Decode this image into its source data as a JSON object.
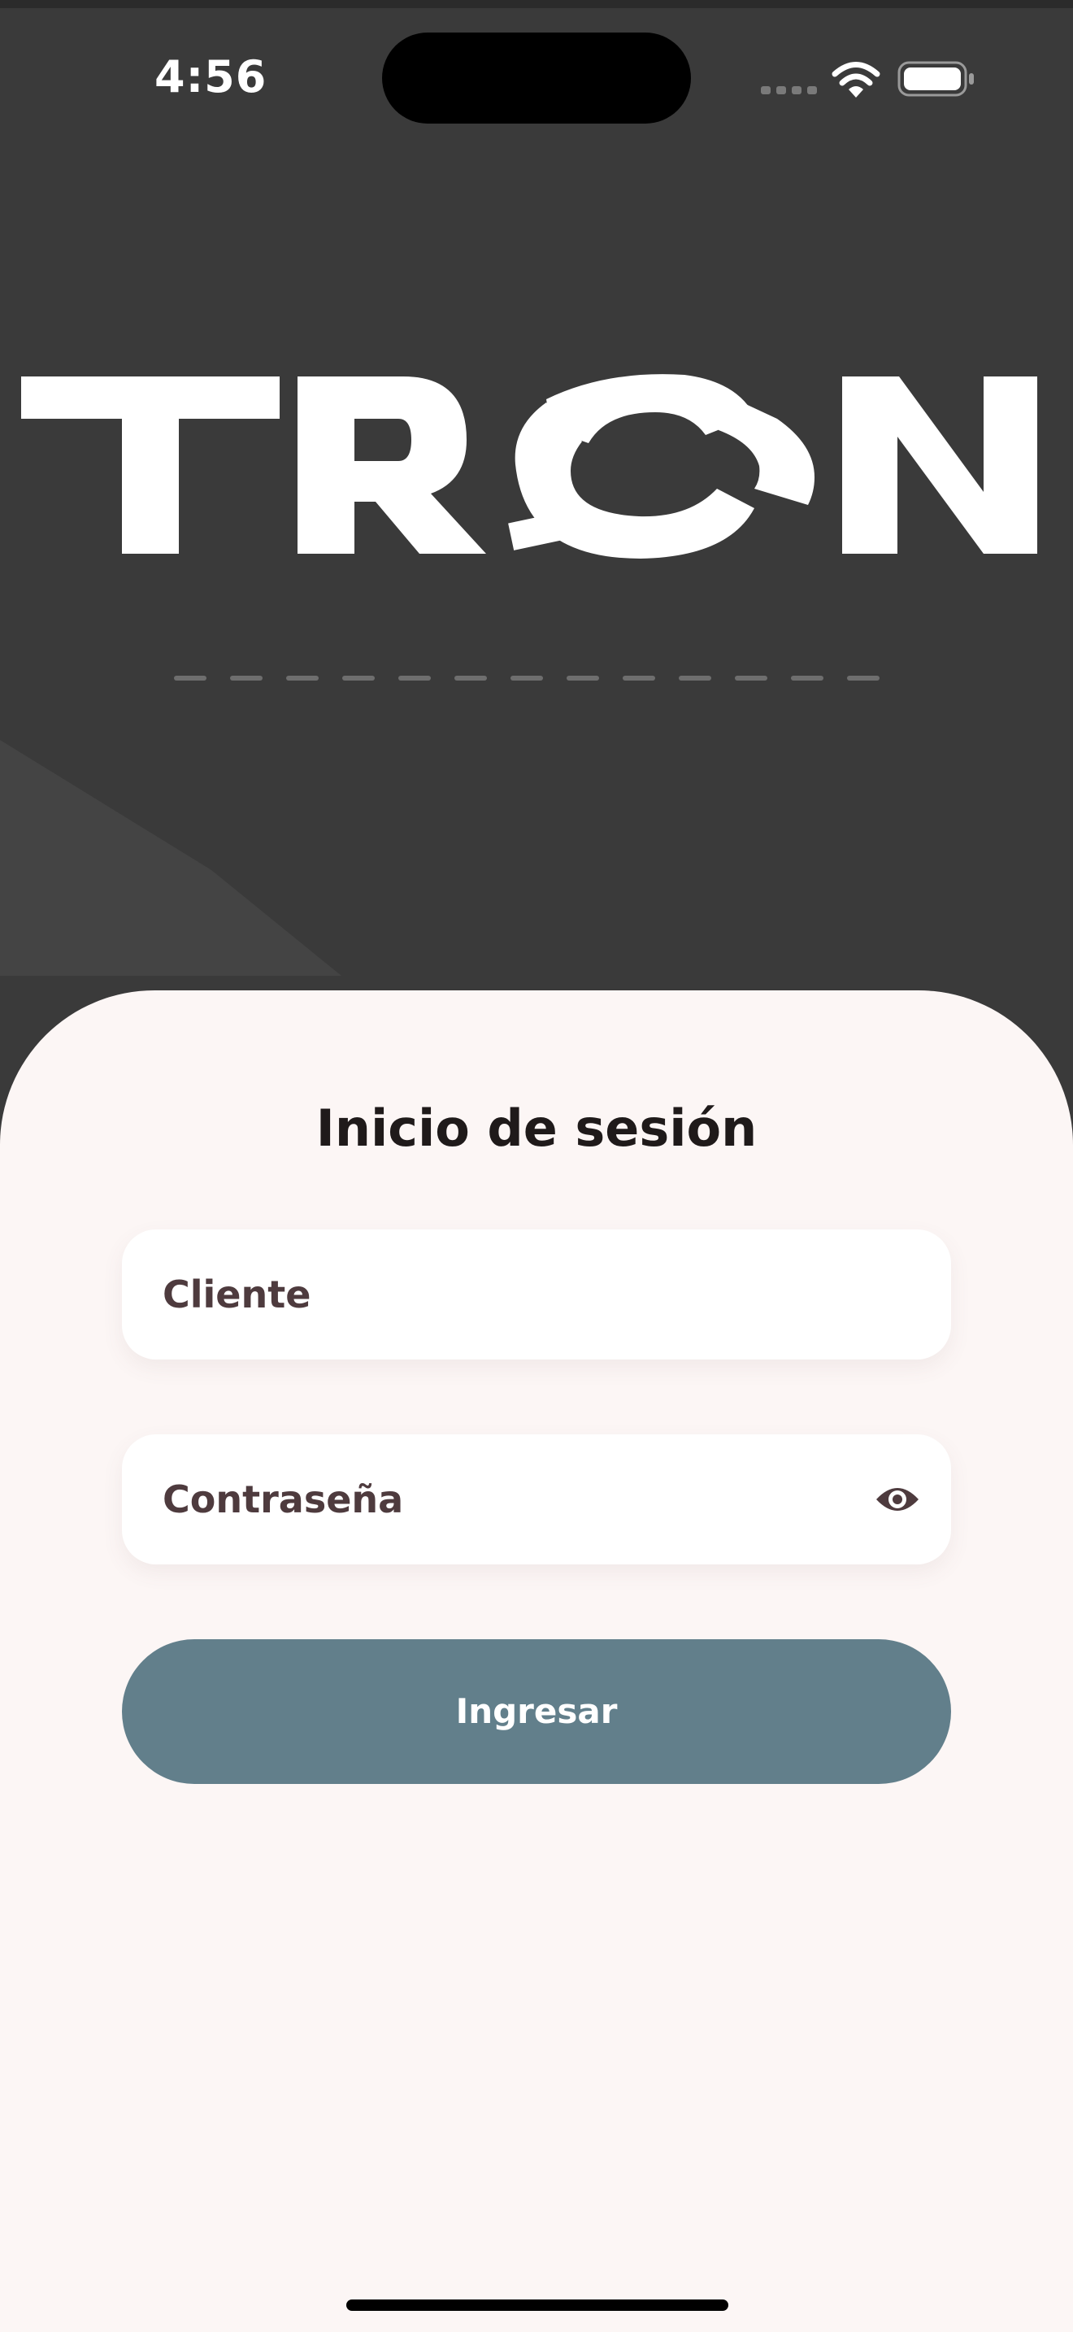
{
  "status_bar": {
    "time": "4:56"
  },
  "brand": {
    "logo_text": "TRON"
  },
  "login": {
    "title": "Inicio de sesión",
    "client_placeholder": "Cliente",
    "password_placeholder": "Contraseña",
    "submit_label": "Ingresar"
  },
  "icons": {
    "wifi": "wifi-icon",
    "battery": "battery-icon",
    "password_toggle": "eye-icon"
  },
  "colors": {
    "header_background": "#3a3a3a",
    "card_background": "#fcf6f5",
    "button_background": "#627f8b",
    "field_text": "#4e3b3e"
  }
}
